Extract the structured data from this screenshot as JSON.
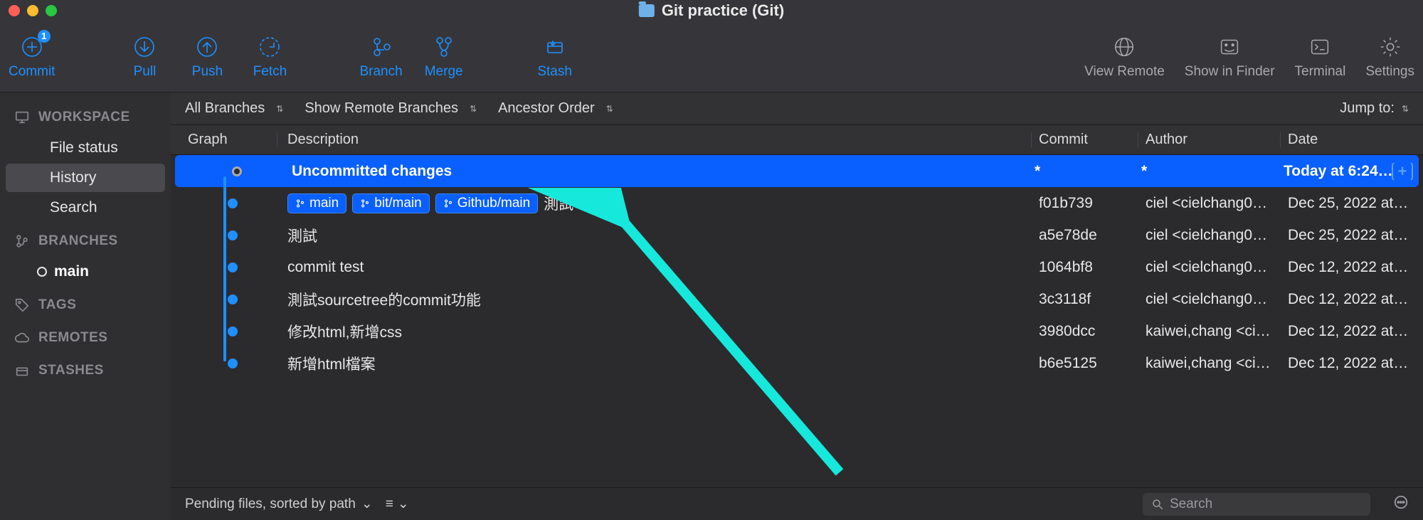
{
  "window": {
    "title": "Git practice (Git)"
  },
  "toolbar": {
    "commit": "Commit",
    "commit_badge": "1",
    "pull": "Pull",
    "push": "Push",
    "fetch": "Fetch",
    "branch": "Branch",
    "merge": "Merge",
    "stash": "Stash",
    "view_remote": "View Remote",
    "show_finder": "Show in Finder",
    "terminal": "Terminal",
    "settings": "Settings"
  },
  "sidebar": {
    "workspace": "WORKSPACE",
    "file_status": "File status",
    "history": "History",
    "search": "Search",
    "branches": "BRANCHES",
    "main": "main",
    "tags": "TAGS",
    "remotes": "REMOTES",
    "stashes": "STASHES"
  },
  "filters": {
    "all_branches": "All Branches",
    "show_remote": "Show Remote Branches",
    "ancestor": "Ancestor Order",
    "jump_to": "Jump to:"
  },
  "columns": {
    "graph": "Graph",
    "description": "Description",
    "commit": "Commit",
    "author": "Author",
    "date": "Date"
  },
  "commits": [
    {
      "desc": "Uncommitted changes",
      "branches": [],
      "commit": "*",
      "author": "*",
      "date": "Today at 6:24…",
      "selected": true,
      "hollow": true
    },
    {
      "desc": "測試",
      "branches": [
        "main",
        "bit/main",
        "Github/main"
      ],
      "commit": "f01b739",
      "author": "ciel <cielchang0…",
      "date": "Dec 25, 2022 at…"
    },
    {
      "desc": "測試",
      "branches": [],
      "commit": "a5e78de",
      "author": "ciel <cielchang0…",
      "date": "Dec 25, 2022 at…"
    },
    {
      "desc": "commit test",
      "branches": [],
      "commit": "1064bf8",
      "author": "ciel <cielchang0…",
      "date": "Dec 12, 2022 at…"
    },
    {
      "desc": "測試sourcetree的commit功能",
      "branches": [],
      "commit": "3c3118f",
      "author": "ciel <cielchang0…",
      "date": "Dec 12, 2022 at…"
    },
    {
      "desc": "修改html,新增css",
      "branches": [],
      "commit": "3980dcc",
      "author": "kaiwei,chang <ci…",
      "date": "Dec 12, 2022 at…"
    },
    {
      "desc": "新增html檔案",
      "branches": [],
      "commit": "b6e5125",
      "author": "kaiwei,chang <ci…",
      "date": "Dec 12, 2022 at…"
    }
  ],
  "bottom": {
    "pending": "Pending files, sorted by path",
    "search_placeholder": "Search"
  }
}
